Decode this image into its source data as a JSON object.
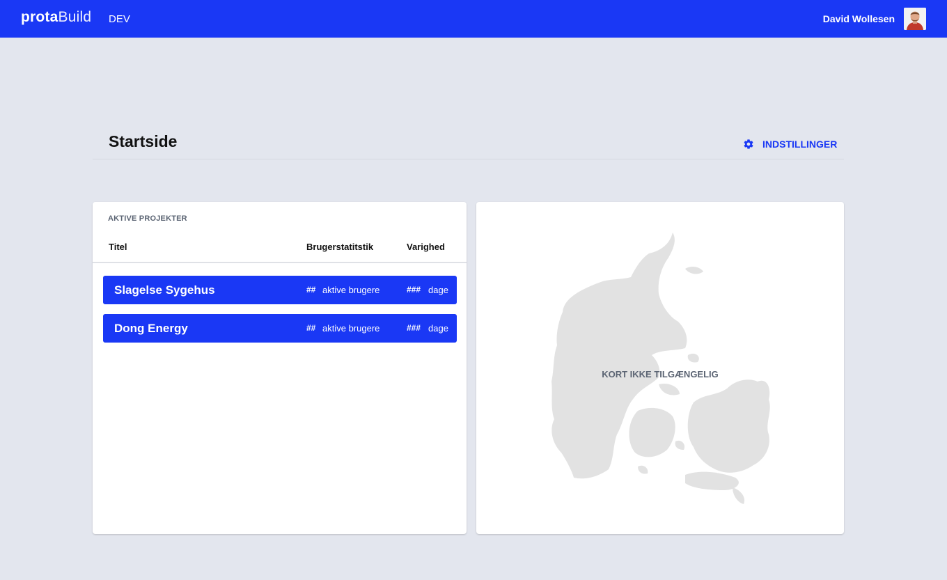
{
  "app": {
    "logo_bold": "prota",
    "logo_light": "Build",
    "environment": "DEV",
    "user_name": "David Wollesen"
  },
  "page": {
    "title": "Startside",
    "settings_label": "INDSTILLINGER"
  },
  "projects": {
    "section_label": "AKTIVE PROJEKTER",
    "columns": [
      "Titel",
      "Brugerstatitstik",
      "Varighed"
    ],
    "rows": [
      {
        "title": "Slagelse Sygehus",
        "users_count": "##",
        "users_label": "aktive brugere",
        "days_count": "###",
        "days_label": "dage"
      },
      {
        "title": "Dong Energy",
        "users_count": "##",
        "users_label": "aktive brugere",
        "days_count": "###",
        "days_label": "dage"
      }
    ]
  },
  "map": {
    "message": "KORT IKKE TILGÆNGELIG"
  },
  "colors": {
    "brand": "#1a38f5",
    "background": "#e3e6ee",
    "map_land": "#e2e2e2"
  },
  "icons": {
    "settings": "gear-icon",
    "avatar": "user-avatar"
  }
}
